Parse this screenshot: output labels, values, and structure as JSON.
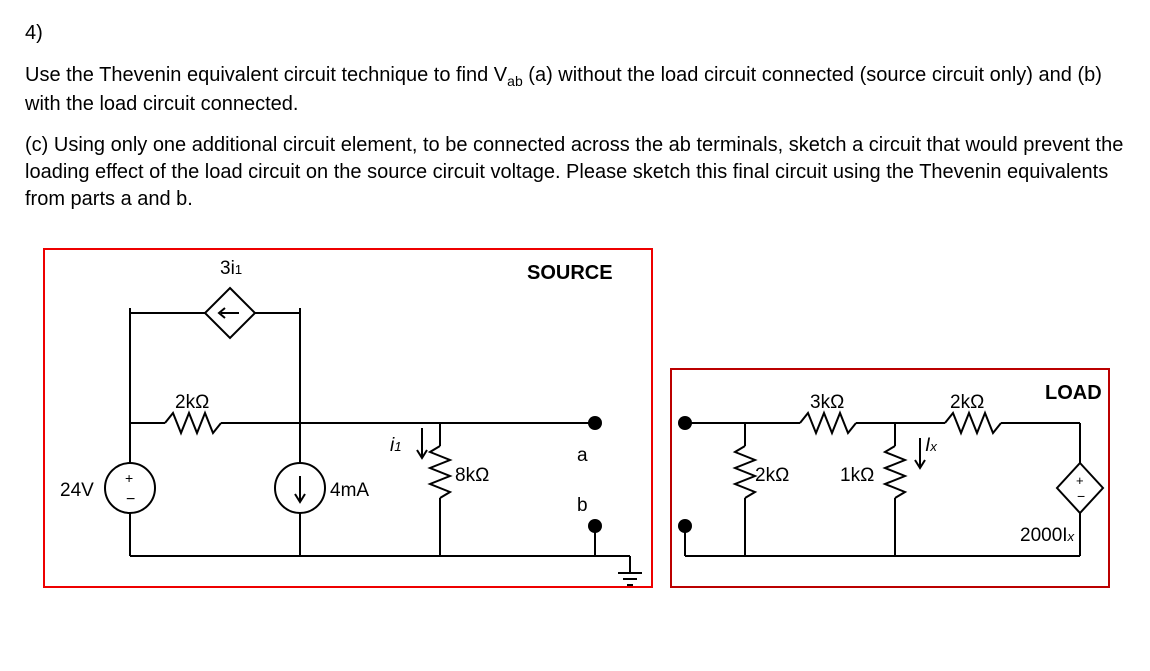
{
  "problem": {
    "number": "4)",
    "para1_prefix": "Use the Thevenin equivalent circuit technique to find V",
    "para1_sub": "ab",
    "para1_suffix": " (a) without the load circuit connected (source circuit only) and (b) with the load circuit connected.",
    "para2": "(c) Using only one additional circuit element, to be connected across the ab terminals, sketch a circuit that would prevent the loading effect of the load circuit on the source circuit voltage. Please sketch this final circuit using the Thevenin equivalents from parts a and b."
  },
  "diagram": {
    "source_label": "SOURCE",
    "load_label": "LOAD",
    "ccvs_label": "3i",
    "ccvs_sub": "1",
    "r2k_left": "2kΩ",
    "vsrc": "24V",
    "isrc": "4mA",
    "i1_label": "i",
    "i1_sub": "1",
    "r8k": "8kΩ",
    "term_a": "a",
    "term_b": "b",
    "r2k_load": "2kΩ",
    "r3k": "3kΩ",
    "r1k": "1kΩ",
    "r2k_right": "2kΩ",
    "ix_label": "I",
    "ix_sub": "x",
    "ccvs_load": "2000I",
    "ccvs_load_sub": "x"
  }
}
